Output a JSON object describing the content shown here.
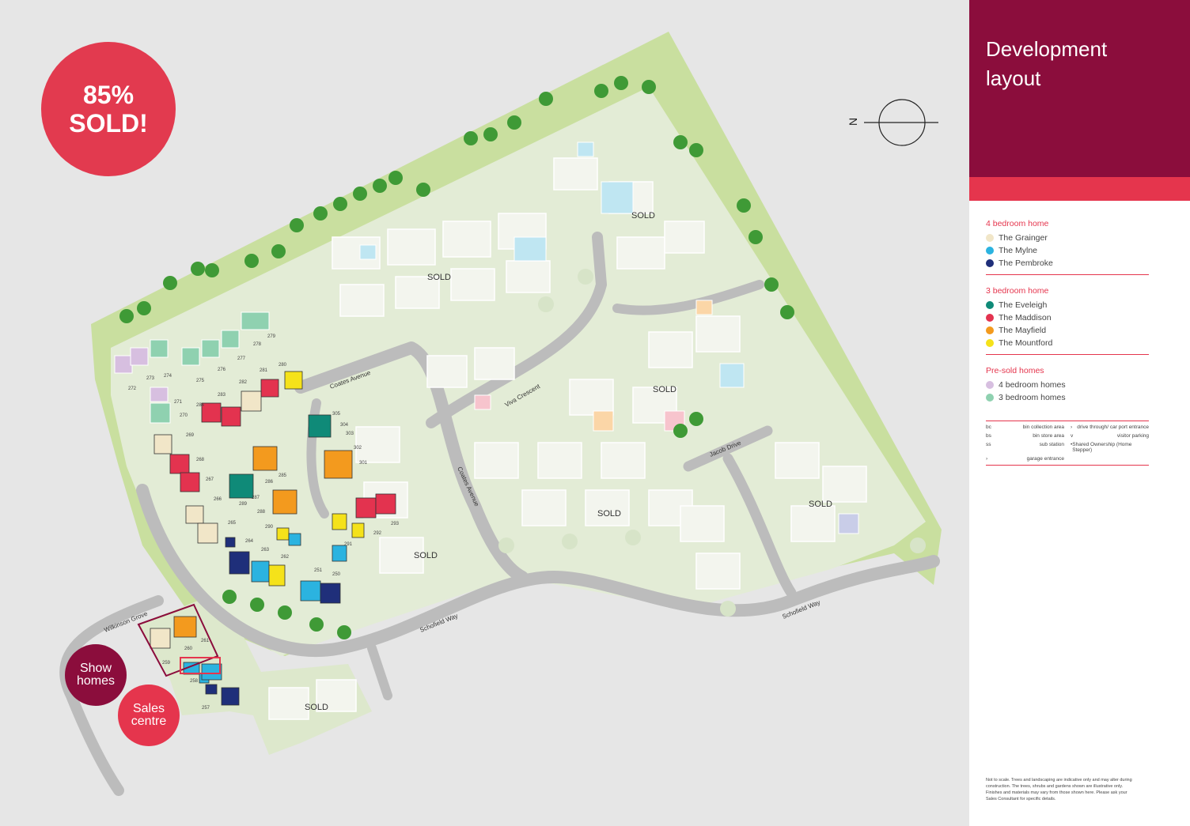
{
  "badge": {
    "percent": "85%",
    "sold": "SOLD!"
  },
  "sidebar": {
    "title_line1": "Development",
    "title_line2": "layout",
    "groups": [
      {
        "heading": "4 bedroom home",
        "items": [
          {
            "label": "The Grainger",
            "color": "#f1e6c8"
          },
          {
            "label": "The Mylne",
            "color": "#2bb3e0"
          },
          {
            "label": "The Pembroke",
            "color": "#1f2f7a"
          }
        ]
      },
      {
        "heading": "3 bedroom home",
        "items": [
          {
            "label": "The Eveleigh",
            "color": "#0f8a78"
          },
          {
            "label": "The Maddison",
            "color": "#e3334f"
          },
          {
            "label": "The Mayfield",
            "color": "#f39a1e"
          },
          {
            "label": "The Mountford",
            "color": "#f5e21a"
          }
        ]
      },
      {
        "heading": "Pre-sold homes",
        "items": [
          {
            "label": "4 bedroom homes",
            "color": "#d7bfe0"
          },
          {
            "label": "3 bedroom homes",
            "color": "#8fd1b0"
          }
        ]
      }
    ],
    "keys": {
      "bin_collection": "bin collection area",
      "bin_store": "bin store area",
      "sub_station": "sub station",
      "garage_entrance": "garage entrance",
      "drive_through": "drive through/ car port entrance",
      "visitor_parking": "visitor parking",
      "shared_ownership": "Shared Ownership (Home Stepper)"
    },
    "disclaimer": "Not to scale. Trees and landscaping are indicative only and may alter during construction. The trees, shrubs and gardens shown are illustrative only. Finishes and materials may vary from those shown here. Please ask your Sales Consultant for specific details."
  },
  "compass": {
    "label": "N"
  },
  "bubbles": {
    "show": [
      "Show",
      "homes"
    ],
    "sales": [
      "Sales",
      "centre"
    ]
  },
  "map": {
    "sold_label": "SOLD",
    "streets": {
      "coates_avenue": "Coates Avenue",
      "viva_crescent": "Viva Crescent",
      "jacob_drive": "Jacob Drive",
      "schofield_way": "Schofield Way",
      "wilkinson_grove": "Wilkinson Grove"
    },
    "colors": {
      "land": "#e3ecd6",
      "grass": "#c9df9f",
      "road": "#bcbcbc",
      "tree": "#3f9a36",
      "sold_plot": "#f3f5ee"
    },
    "plot_numbers": [
      "272",
      "273",
      "274",
      "275",
      "276",
      "277",
      "278",
      "279",
      "280",
      "281",
      "282",
      "283",
      "284",
      "285",
      "286",
      "287",
      "288",
      "289",
      "290",
      "291",
      "292",
      "293",
      "301",
      "302",
      "303",
      "304",
      "305",
      "257",
      "258",
      "259",
      "260",
      "261",
      "262",
      "263",
      "264",
      "265",
      "266",
      "267",
      "268",
      "269",
      "270",
      "271",
      "250",
      "251"
    ]
  }
}
